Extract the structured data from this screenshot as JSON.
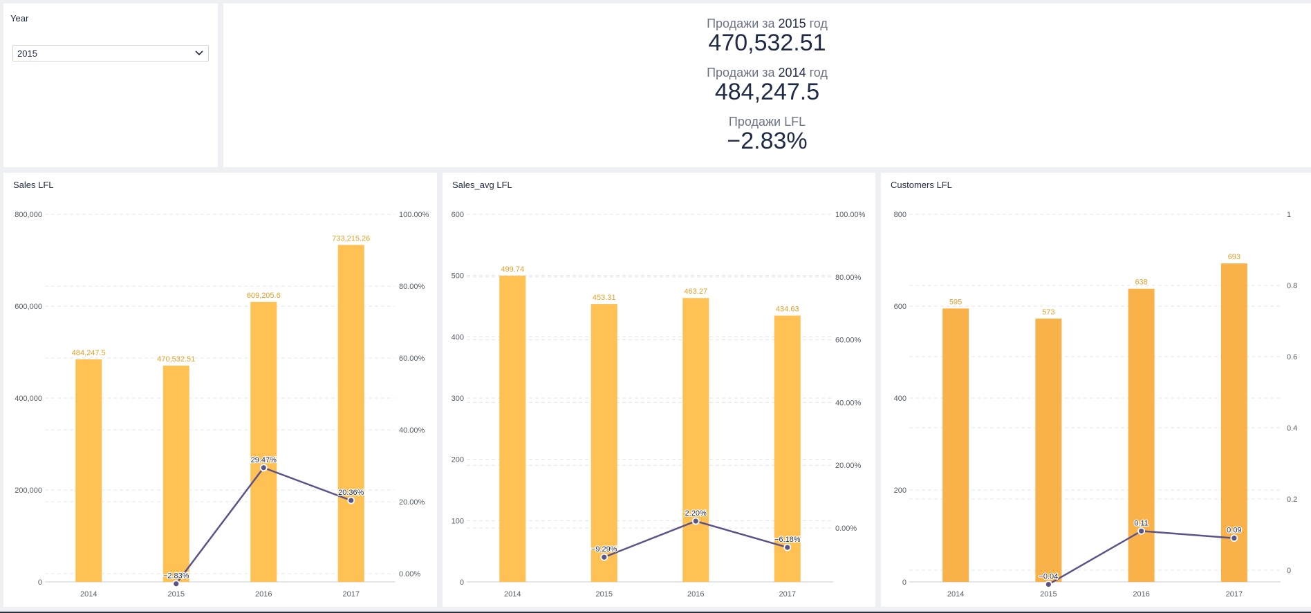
{
  "filter": {
    "title": "Year",
    "selected": "2015",
    "chevron_icon": "chevron-down-icon"
  },
  "kpis": [
    {
      "label_prefix": "Продажи за ",
      "label_year": "2015",
      "label_suffix": " год",
      "value": "470,532.51"
    },
    {
      "label_prefix": "Продажи за ",
      "label_year": "2014",
      "label_suffix": " год",
      "value": "484,247.5"
    },
    {
      "label_prefix": "Продажи LFL",
      "label_year": "",
      "label_suffix": "",
      "value": "−2.83%"
    }
  ],
  "colors": {
    "bar": "#ffc154",
    "bar_alt": "#f9b24a",
    "bar_label": "#e3a028",
    "line": "#5b5288",
    "axis_text": "#555b66",
    "grid": "#e2e4e8"
  },
  "chart_data": [
    {
      "type": "bar",
      "title": "Sales LFL",
      "categories": [
        "2014",
        "2015",
        "2016",
        "2017"
      ],
      "series": [
        {
          "values": [
            484247.5,
            470532.51,
            609205.6,
            733215.26
          ],
          "labels": [
            "484,247.5",
            "470,532.51",
            "609,205.6",
            "733,215.26"
          ]
        },
        {
          "type": "line",
          "axis": "right",
          "values": [
            null,
            -2.83,
            29.47,
            20.36
          ],
          "labels": [
            "",
            "−2.83%",
            "29.47%",
            "20.36%"
          ]
        }
      ],
      "ylim": [
        0,
        800000
      ],
      "y_ticks": [
        "0",
        "200,000",
        "400,000",
        "600,000",
        "800,000"
      ],
      "y2lim": [
        0,
        100
      ],
      "y2_ticks": [
        "0.00%",
        "20.00%",
        "40.00%",
        "60.00%",
        "80.00%",
        "100.00%"
      ],
      "grid": true
    },
    {
      "type": "bar",
      "title": "Sales_avg LFL",
      "categories": [
        "2014",
        "2015",
        "2016",
        "2017"
      ],
      "series": [
        {
          "values": [
            499.74,
            453.31,
            463.27,
            434.63
          ],
          "labels": [
            "499.74",
            "453.31",
            "463.27",
            "434.63"
          ]
        },
        {
          "type": "line",
          "axis": "right",
          "values": [
            null,
            -9.29,
            2.2,
            -6.18
          ],
          "labels": [
            "",
            "−9.29%",
            "2.20%",
            "−6.18%"
          ]
        }
      ],
      "ylim": [
        0,
        600
      ],
      "y_ticks": [
        "0",
        "100",
        "200",
        "300",
        "400",
        "500",
        "600"
      ],
      "y2lim": [
        -7.7,
        100
      ],
      "y2_ticks": [
        "0.00%",
        "20.00%",
        "40.00%",
        "60.00%",
        "80.00%",
        "100.00%"
      ],
      "grid": true
    },
    {
      "type": "bar",
      "title": "Customers LFL",
      "categories": [
        "2014",
        "2015",
        "2016",
        "2017"
      ],
      "series": [
        {
          "values": [
            595,
            573,
            638,
            693
          ],
          "labels": [
            "595",
            "573",
            "638",
            "693"
          ]
        },
        {
          "type": "line",
          "axis": "right",
          "values": [
            null,
            -0.04,
            0.11,
            0.09
          ],
          "labels": [
            "",
            "−0.04",
            "0.11",
            "0.09"
          ]
        }
      ],
      "ylim": [
        0,
        800
      ],
      "y_ticks": [
        "0",
        "200",
        "400",
        "600",
        "800"
      ],
      "y2lim": [
        0,
        1
      ],
      "y2_ticks": [
        "0",
        "0.2",
        "0.4",
        "0.6",
        "0.8",
        "1"
      ],
      "grid": true
    }
  ]
}
